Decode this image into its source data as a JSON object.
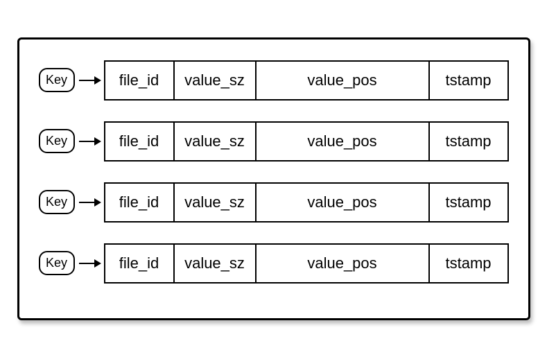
{
  "rows": [
    {
      "key_label": "Key",
      "fields": {
        "file_id": "file_id",
        "value_sz": "value_sz",
        "value_pos": "value_pos",
        "tstamp": "tstamp"
      }
    },
    {
      "key_label": "Key",
      "fields": {
        "file_id": "file_id",
        "value_sz": "value_sz",
        "value_pos": "value_pos",
        "tstamp": "tstamp"
      }
    },
    {
      "key_label": "Key",
      "fields": {
        "file_id": "file_id",
        "value_sz": "value_sz",
        "value_pos": "value_pos",
        "tstamp": "tstamp"
      }
    },
    {
      "key_label": "Key",
      "fields": {
        "file_id": "file_id",
        "value_sz": "value_sz",
        "value_pos": "value_pos",
        "tstamp": "tstamp"
      }
    }
  ]
}
